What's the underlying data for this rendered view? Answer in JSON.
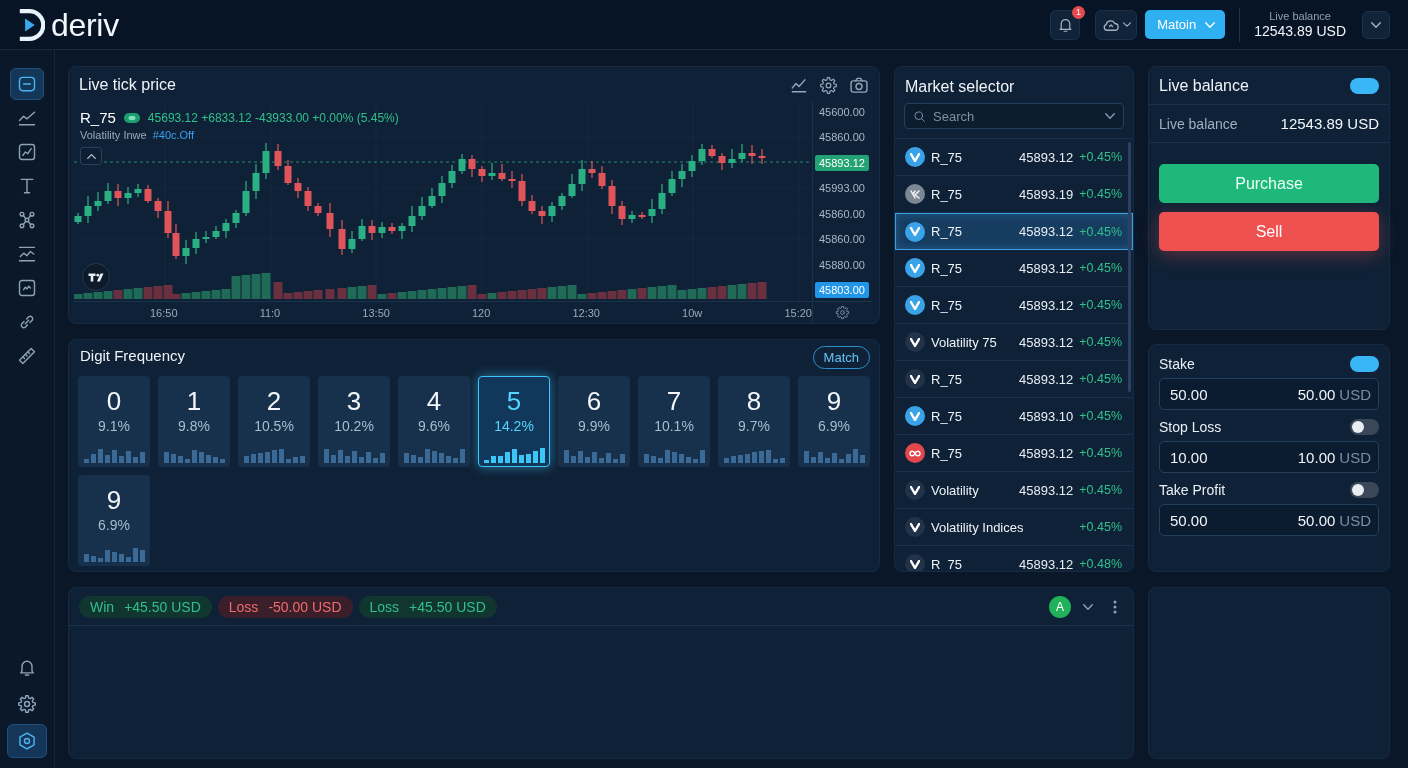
{
  "header": {
    "logo": "deriv",
    "notifications": {
      "count": "1"
    },
    "account": {
      "label": "Matoin"
    },
    "balance": {
      "label": "Live balance",
      "value": "12543.89 USD"
    }
  },
  "sidebar": {
    "tools": [
      {
        "kind": "panel",
        "selected": true
      },
      {
        "kind": "trend",
        "selected": false
      },
      {
        "kind": "chart",
        "selected": false
      },
      {
        "kind": "text",
        "selected": false
      },
      {
        "kind": "nodes",
        "selected": false
      },
      {
        "kind": "indicators",
        "selected": false
      },
      {
        "kind": "widget",
        "selected": false
      },
      {
        "kind": "link",
        "selected": false
      },
      {
        "kind": "ruler",
        "selected": false
      }
    ],
    "footer": [
      {
        "kind": "bell",
        "selected": false
      },
      {
        "kind": "gear",
        "selected": false
      },
      {
        "kind": "hexagon",
        "selected": true
      }
    ]
  },
  "chart_panel": {
    "title": "Live tick price",
    "symbol": "R_75",
    "quote": "45693.12 +6833.12 -43933.00 +0.00% (5.45%)",
    "study": {
      "label": "Volatility Inwe",
      "value": "#40c.Off"
    },
    "price_labels": [
      {
        "text": "45600.00",
        "kind": "plain"
      },
      {
        "text": "45860.00",
        "kind": "plain"
      },
      {
        "text": "45893.12",
        "kind": "last"
      },
      {
        "text": "45993.00",
        "kind": "plain"
      },
      {
        "text": "45860.00",
        "kind": "plain"
      },
      {
        "text": "45860.00",
        "kind": "plain"
      },
      {
        "text": "45880.00",
        "kind": "plain"
      },
      {
        "text": "45803.00",
        "kind": "cursor"
      }
    ],
    "time_labels": [
      "16:50",
      "11:0",
      "13:50",
      "120",
      "12:30",
      "10w",
      "15:20"
    ]
  },
  "digit_frequency": {
    "title": "Digit Frequency",
    "action": "Match",
    "digits": [
      {
        "digit": "0",
        "percent": "9.1%",
        "selected": false
      },
      {
        "digit": "1",
        "percent": "9.8%",
        "selected": false
      },
      {
        "digit": "2",
        "percent": "10.5%",
        "selected": false
      },
      {
        "digit": "3",
        "percent": "10.2%",
        "selected": false
      },
      {
        "digit": "4",
        "percent": "9.6%",
        "selected": false
      },
      {
        "digit": "5",
        "percent": "14.2%",
        "selected": true
      },
      {
        "digit": "6",
        "percent": "9.9%",
        "selected": false
      },
      {
        "digit": "7",
        "percent": "10.1%",
        "selected": false
      },
      {
        "digit": "8",
        "percent": "9.7%",
        "selected": false
      },
      {
        "digit": "9",
        "percent": "6.9%",
        "selected": false
      },
      {
        "digit": "9",
        "percent": "6.9%",
        "selected": false
      }
    ]
  },
  "market_selector": {
    "title": "Market selector",
    "search": {
      "placeholder": "Search"
    },
    "markets": [
      {
        "name": "R_75",
        "price": "45893.12",
        "change": "+0.45%",
        "kind": "v",
        "color": "#3aa3e8",
        "selected": false
      },
      {
        "name": "R_75",
        "price": "45893.19",
        "change": "+0.45%",
        "kind": "mark",
        "color": "#7d8794",
        "selected": false
      },
      {
        "name": "R_75",
        "price": "45893.12",
        "change": "+0.45%",
        "kind": "v",
        "color": "#3aa3e8",
        "selected": true
      },
      {
        "name": "R_75",
        "price": "45893.12",
        "change": "+0.45%",
        "kind": "v",
        "color": "#3aa3e8",
        "selected": false
      },
      {
        "name": "R_75",
        "price": "45893.12",
        "change": "+0.45%",
        "kind": "v",
        "color": "#3aa3e8",
        "selected": false
      },
      {
        "name": "Volatility 75",
        "price": "45893.12",
        "change": "+0.45%",
        "kind": "v",
        "color": "#223249",
        "selected": false
      },
      {
        "name": "R_75",
        "price": "45893.12",
        "change": "+0.45%",
        "kind": "v",
        "color": "#223249",
        "selected": false
      },
      {
        "name": "R_75",
        "price": "45893.10",
        "change": "+0.45%",
        "kind": "v",
        "color": "#3aa3e8",
        "selected": false
      },
      {
        "name": "R_75",
        "price": "45893.12",
        "change": "+0.45%",
        "kind": "loop",
        "color": "#e2474c",
        "selected": false
      },
      {
        "name": "Volatility",
        "price": "45893.12",
        "change": "+0.45%",
        "kind": "v",
        "color": "#223249",
        "selected": false
      },
      {
        "name": "Volatility Indices",
        "change": "+0.45%",
        "kind": "v",
        "color": "#223249",
        "selected": false
      },
      {
        "name": "R_75",
        "price": "45893.12",
        "change": "+0.48%",
        "kind": "v",
        "color": "#223249",
        "selected": false
      }
    ]
  },
  "balance_panel": {
    "title": "Live balance",
    "enabled": true,
    "balance_label": "Live balance",
    "balance_value": "12543.89 USD",
    "actions": [
      {
        "label": "Purchase",
        "kind": "buy"
      },
      {
        "label": "Sell",
        "kind": "sell"
      }
    ]
  },
  "risk_panel": {
    "fields": [
      {
        "label": "Stake",
        "on": true,
        "value": "50.00",
        "amount": "50.00",
        "currency": "USD"
      },
      {
        "label": "Stop Loss",
        "on": false,
        "value": "10.00",
        "amount": "10.00",
        "currency": "USD"
      },
      {
        "label": "Take Profit",
        "on": false,
        "value": "50.00",
        "amount": "50.00",
        "currency": "USD"
      }
    ]
  },
  "positions": {
    "results": [
      {
        "label": "Win",
        "amount": "+45.50 USD",
        "kind": "gain"
      },
      {
        "label": "Loss",
        "amount": "-50.00 USD",
        "kind": "loss"
      },
      {
        "label": "Loss",
        "amount": "+45.50 USD",
        "kind": "gain"
      }
    ],
    "avatar": "A"
  }
}
